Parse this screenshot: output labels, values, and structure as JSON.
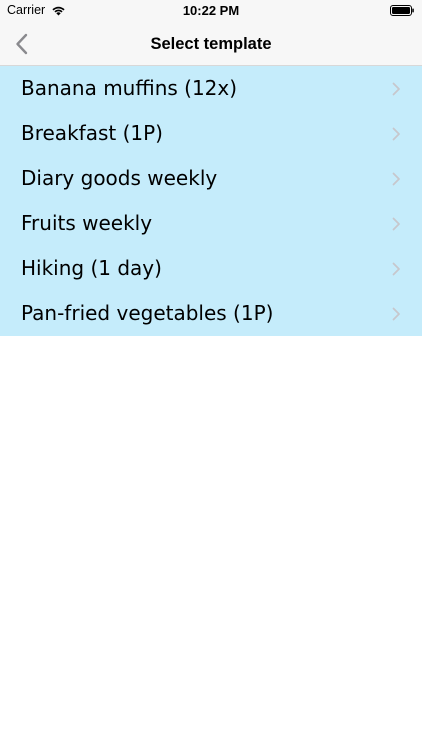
{
  "status_bar": {
    "carrier": "Carrier",
    "time": "10:22 PM",
    "icons": [
      "wifi-icon",
      "battery-icon"
    ]
  },
  "nav": {
    "title": "Select template",
    "back_icon": "chevron-left-icon"
  },
  "templates": [
    {
      "label": "Banana muffins (12x)"
    },
    {
      "label": "Breakfast (1P)"
    },
    {
      "label": "Diary goods weekly"
    },
    {
      "label": "Fruits weekly"
    },
    {
      "label": "Hiking (1 day)"
    },
    {
      "label": "Pan-fried vegetables (1P)"
    }
  ],
  "colors": {
    "row_background": "#c5ecfb",
    "bar_background": "#f7f7f7",
    "chevron": "#c7c7cc",
    "back_arrow": "#8a8a8e"
  }
}
